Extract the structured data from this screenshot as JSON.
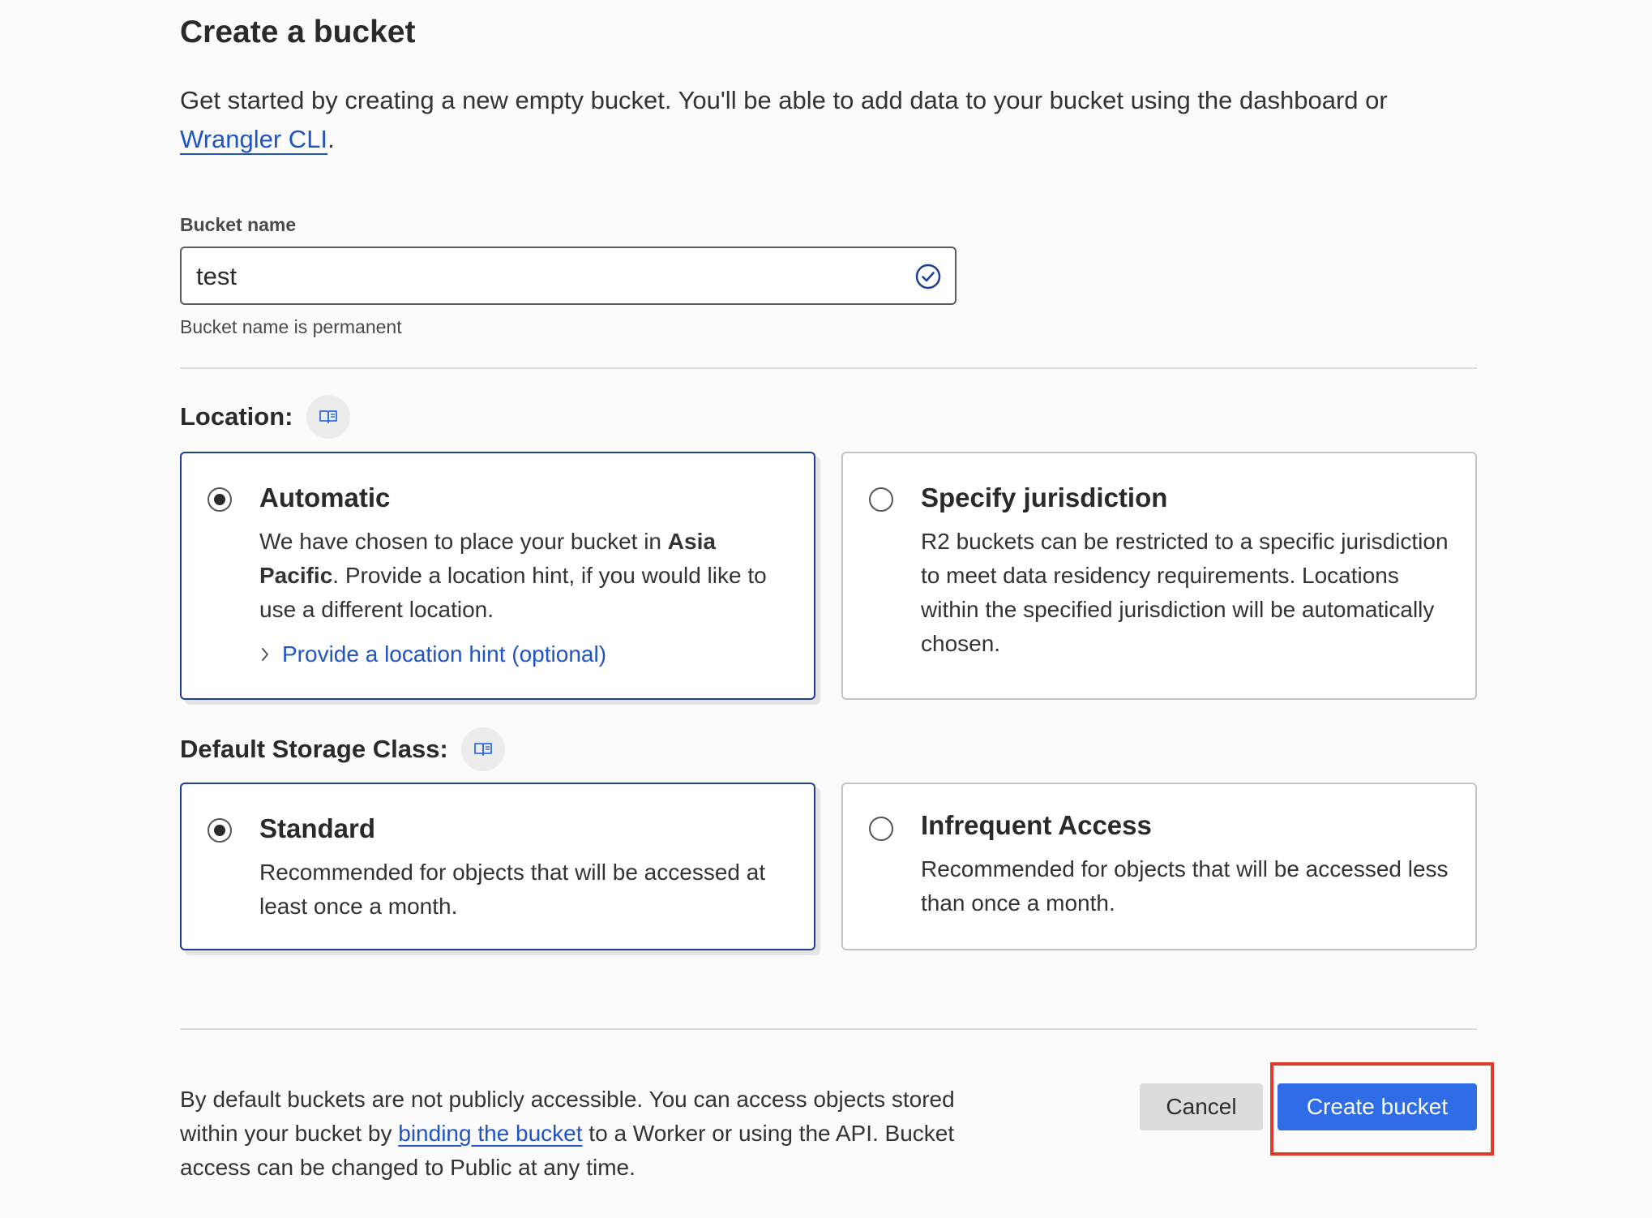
{
  "header": {
    "title": "Create a bucket",
    "intro_text": "Get started by creating a new empty bucket. You'll be able to add data to your bucket using the dashboard or",
    "intro_link": "Wrangler CLI",
    "intro_end": "."
  },
  "bucket_name": {
    "label": "Bucket name",
    "value": "test",
    "help": "Bucket name is permanent",
    "valid_icon": "check-circle-icon"
  },
  "location": {
    "label": "Location:",
    "doc_icon": "book-icon",
    "options": [
      {
        "title": "Automatic",
        "selected": true,
        "desc_pre": "We have chosen to place your bucket in ",
        "desc_bold": "Asia Pacific",
        "desc_post": ". Provide a location hint, if you would like to use a different location.",
        "hint_label": "Provide a location hint (optional)"
      },
      {
        "title": "Specify jurisdiction",
        "selected": false,
        "desc": "R2 buckets can be restricted to a specific jurisdiction to meet data residency requirements. Locations within the specified jurisdiction will be automatically chosen."
      }
    ]
  },
  "storage_class": {
    "label": "Default Storage Class:",
    "doc_icon": "book-icon",
    "options": [
      {
        "title": "Standard",
        "selected": true,
        "desc": "Recommended for objects that will be accessed at least once a month."
      },
      {
        "title": "Infrequent Access",
        "selected": false,
        "desc": "Recommended for objects that will be accessed less than once a month."
      }
    ]
  },
  "footer": {
    "text_pre": "By default buckets are not publicly accessible. You can access objects stored within your bucket by ",
    "link": "binding the bucket",
    "text_post": " to a Worker or using the API. Bucket access can be changed to Public at any time.",
    "cancel_label": "Cancel",
    "create_label": "Create bucket"
  },
  "colors": {
    "accent": "#2e6de6",
    "link": "#1f54c7",
    "selected_border": "#1d3f9a",
    "highlight": "#e03a2e"
  }
}
